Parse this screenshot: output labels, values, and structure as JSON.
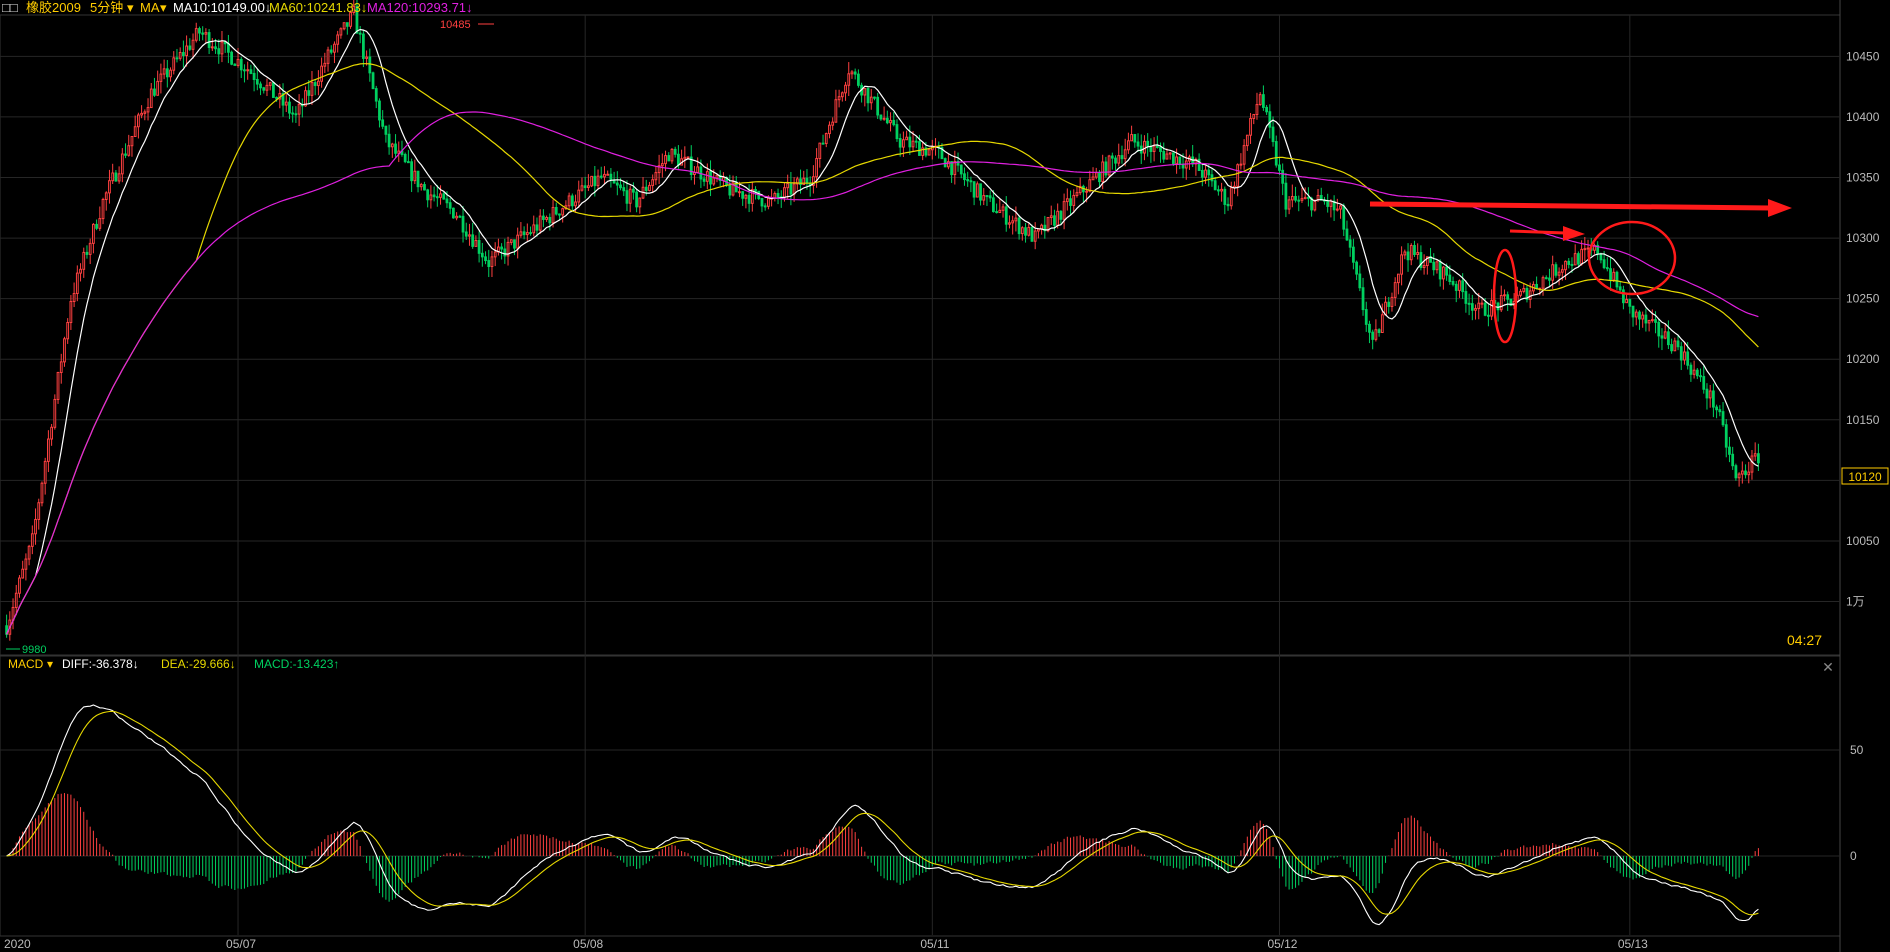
{
  "header": {
    "symbol": "橡胶2009",
    "period": "5分钟",
    "indicator": "MA",
    "ma10": "MA10:10149.00↓",
    "ma60": "MA60:10241.83↓",
    "ma120": "MA120:10293.71↓",
    "icon": "contract-icon"
  },
  "price_panel": {
    "y_ticks": [
      "10450",
      "10400",
      "10350",
      "10300",
      "10250",
      "10200",
      "10150",
      "10100",
      "10050",
      "1万"
    ],
    "current_price": "10120",
    "time_remaining": "04:27",
    "high_marker": "10485",
    "low_marker": "9980"
  },
  "macd_panel": {
    "label": "MACD",
    "diff": "DIFF:-36.378↓",
    "dea": "DEA:-29.666↓",
    "macd": "MACD:-13.423↑",
    "y_ticks": [
      "50",
      "0"
    ]
  },
  "x_labels": [
    "2020",
    "05/07",
    "05/08",
    "05/11",
    "05/12",
    "05/13"
  ],
  "colors": {
    "up": "#ff4040",
    "down": "#00d060",
    "ma10": "#ffffff",
    "ma60": "#e6d800",
    "ma120": "#e020e0",
    "grid": "#262626",
    "annotation": "#ff1a1a"
  },
  "chart_data": {
    "type": "candlestick",
    "price_scale": [
      9960,
      10480
    ],
    "x_sessions": [
      "05/07",
      "05/08",
      "05/11",
      "05/12",
      "05/13"
    ],
    "price_waypoints": [
      [
        0,
        9980
      ],
      [
        8,
        10050
      ],
      [
        20,
        10250
      ],
      [
        30,
        10330
      ],
      [
        45,
        10420
      ],
      [
        60,
        10470
      ],
      [
        75,
        10440
      ],
      [
        90,
        10400
      ],
      [
        100,
        10450
      ],
      [
        108,
        10485
      ],
      [
        118,
        10380
      ],
      [
        130,
        10340
      ],
      [
        140,
        10320
      ],
      [
        150,
        10280
      ],
      [
        165,
        10310
      ],
      [
        185,
        10350
      ],
      [
        196,
        10330
      ],
      [
        206,
        10370
      ],
      [
        225,
        10340
      ],
      [
        238,
        10330
      ],
      [
        250,
        10350
      ],
      [
        262,
        10440
      ],
      [
        278,
        10380
      ],
      [
        290,
        10370
      ],
      [
        305,
        10330
      ],
      [
        320,
        10300
      ],
      [
        335,
        10340
      ],
      [
        350,
        10380
      ],
      [
        370,
        10360
      ],
      [
        380,
        10330
      ],
      [
        390,
        10420
      ],
      [
        398,
        10330
      ],
      [
        410,
        10330
      ],
      [
        415,
        10320
      ],
      [
        425,
        10210
      ],
      [
        435,
        10290
      ],
      [
        448,
        10270
      ],
      [
        458,
        10240
      ],
      [
        470,
        10250
      ],
      [
        485,
        10280
      ],
      [
        495,
        10290
      ],
      [
        505,
        10240
      ],
      [
        520,
        10210
      ],
      [
        532,
        10160
      ],
      [
        538,
        10100
      ],
      [
        545,
        10120
      ]
    ],
    "ma_final": {
      "MA10": 10149.0,
      "MA60": 10241.83,
      "MA120": 10293.71
    },
    "macd_final": {
      "DIFF": -36.378,
      "DEA": -29.666,
      "MACD": -13.423
    },
    "macd_scale": [
      -36,
      90
    ],
    "annotations": [
      {
        "type": "arrow",
        "desc": "resistance at MA120 around 10330"
      },
      {
        "type": "arrow",
        "desc": "pointing to rejection at 10300"
      },
      {
        "type": "ellipse",
        "desc": "pullback near 10280"
      },
      {
        "type": "ellipse",
        "desc": "rejection near 10300"
      }
    ]
  }
}
